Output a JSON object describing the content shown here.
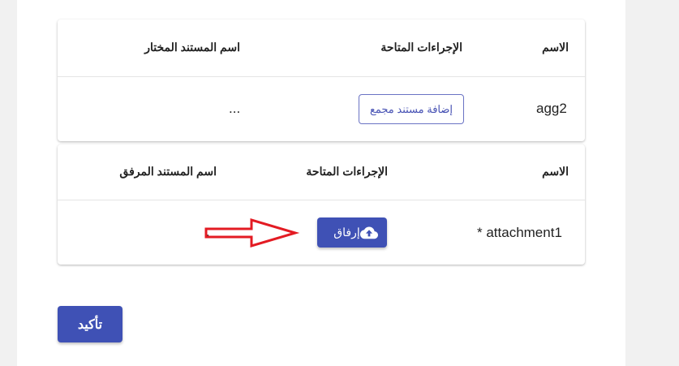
{
  "table1": {
    "headers": {
      "name": "الاسم",
      "actions": "الإجراءات المتاحة",
      "document": "اسم المستند المختار"
    },
    "row": {
      "name": "agg2",
      "action_button": "إضافة مستند مجمع",
      "document": "..."
    }
  },
  "table2": {
    "headers": {
      "name": "الاسم",
      "actions": "الإجراءات المتاحة",
      "document": "اسم المستند المرفق"
    },
    "row": {
      "name": "* attachment1",
      "upload_button": "إرفاق",
      "upload_icon": "cloud-upload-icon",
      "document": "."
    }
  },
  "annotation": {
    "arrow_color": "#e31b23"
  },
  "confirm_button": "تأكيد",
  "colors": {
    "primary": "#3f51b5",
    "background": "#f1f1f1",
    "card": "#ffffff"
  }
}
